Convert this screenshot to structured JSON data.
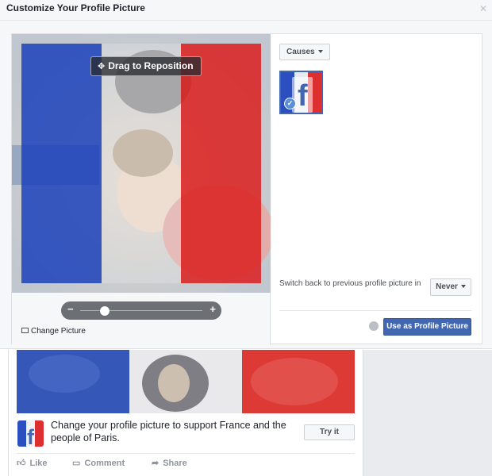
{
  "dialog": {
    "title": "Customize Your Profile Picture",
    "close_icon": "close-icon"
  },
  "editor": {
    "drag_label": "Drag to Reposition",
    "zoom_level": 0.2,
    "zoom_minus": "−",
    "zoom_plus": "+",
    "change_picture_label": "Change Picture"
  },
  "side": {
    "causes_label": "Causes",
    "switch_back_label": "Switch back to previous profile picture in",
    "never_label": "Never",
    "use_button_label": "Use as Profile Picture"
  },
  "feed": {
    "promo_text": "Change your profile picture to support France and the people of Paris.",
    "try_it_label": "Try it",
    "like_label": "Like",
    "comment_label": "Comment",
    "share_label": "Share"
  },
  "colors": {
    "flag_blue": "#2c4fc0",
    "flag_white": "#ffffff",
    "flag_red": "#dd2f2f",
    "facebook_blue": "#4267b2"
  }
}
